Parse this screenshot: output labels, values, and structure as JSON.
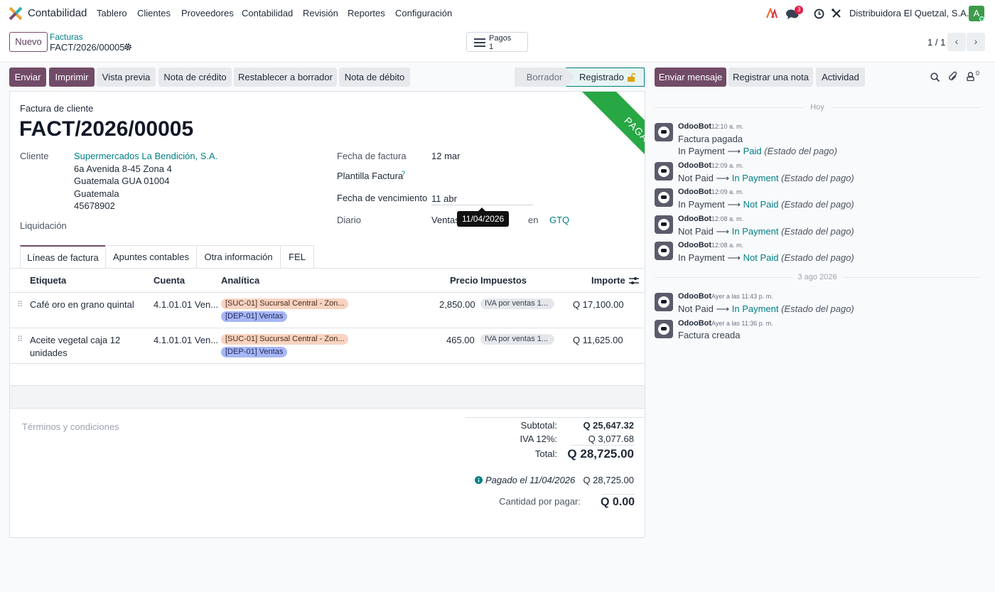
{
  "navbar": {
    "app_name": "Contabilidad",
    "menus": [
      "Tablero",
      "Clientes",
      "Proveedores",
      "Contabilidad",
      "Revisión",
      "Reportes",
      "Configuración"
    ],
    "messages_count": "3",
    "company": "Distribuidora El Quetzal, S.A.",
    "avatar_letter": "A"
  },
  "control": {
    "new_label": "Nuevo",
    "breadcrumb_parent": "Facturas",
    "breadcrumb_current": "FACT/2026/00005",
    "payments_label": "Pagos",
    "payments_count": "1",
    "pager": "1 / 1"
  },
  "actions": {
    "send": "Enviar",
    "print": "Imprimir",
    "preview": "Vista previa",
    "credit_note": "Nota de crédito",
    "reset_draft": "Restablecer a borrador",
    "debit_note": "Nota de débito"
  },
  "status": {
    "draft": "Borrador",
    "posted": "Registrado"
  },
  "form": {
    "ribbon": "PAGADO",
    "type": "Factura de cliente",
    "number": "FACT/2026/00005",
    "customer_label": "Cliente",
    "customer_name": "Supermercados La Bendición, S.A.",
    "address": [
      "6a Avenida 8-45 Zona 4",
      "Guatemala GUA 01004",
      "Guatemala",
      "45678902"
    ],
    "liquidation_label": "Liquidación",
    "invoice_date_label": "Fecha de factura",
    "invoice_date": "12 mar",
    "template_label": "Plantilla Factura",
    "template_help": "?",
    "due_date_label": "Fecha de vencimiento",
    "due_date": "11 abr",
    "due_tooltip": "11/04/2026",
    "journal_label": "Diario",
    "journal": "Ventas",
    "in_label": "en",
    "currency": "GTQ"
  },
  "tabs": [
    "Líneas de factura",
    "Apuntes contables",
    "Otra información",
    "FEL"
  ],
  "lines": {
    "headers": [
      "Etiqueta",
      "Cuenta",
      "Analítica",
      "Precio",
      "Impuestos",
      "Importe"
    ],
    "rows": [
      {
        "label": "Café oro en grano quintal",
        "account": "4.1.01.01 Ven...",
        "tag1": "[SUC-01] Sucursal Central - Zon...",
        "tag2": "[DEP-01] Ventas",
        "price": "2,850.00",
        "tax": "IVA por ventas 1...",
        "amount": "Q 17,100.00"
      },
      {
        "label": "Aceite vegetal caja 12 unidades",
        "account": "4.1.01.01 Ven...",
        "tag1": "[SUC-01] Sucursal Central - Zon...",
        "tag2": "[DEP-01] Ventas",
        "price": "465.00",
        "tax": "IVA por ventas 1...",
        "amount": "Q 11,625.00"
      }
    ]
  },
  "terms_placeholder": "Términos y condiciones",
  "totals": {
    "subtotal_label": "Subtotal:",
    "subtotal": "Q 25,647.32",
    "tax_label": "IVA 12%:",
    "tax": "Q 3,077.68",
    "total_label": "Total:",
    "total": "Q 28,725.00",
    "paid_label": "Pagado el 11/04/2026",
    "paid": "Q 28,725.00",
    "due_label": "Cantidad por pagar:",
    "due": "Q 0.00"
  },
  "chatter": {
    "send_message": "Enviar mensaje",
    "log_note": "Registrar una nota",
    "activity": "Actividad",
    "followers_count": "0",
    "today": "Hoy",
    "older_date": "3 ago 2026",
    "messages": [
      {
        "author": "OdooBot",
        "time": "12:10 a. m.",
        "title": "Factura pagada",
        "old": "In Payment",
        "new": "Paid",
        "field": "(Estado del pago)"
      },
      {
        "author": "OdooBot",
        "time": "12:09 a. m.",
        "old": "Not Paid",
        "new": "In Payment",
        "field": "(Estado del pago)"
      },
      {
        "author": "OdooBot",
        "time": "12:09 a. m.",
        "old": "In Payment",
        "new": "Not Paid",
        "field": "(Estado del pago)"
      },
      {
        "author": "OdooBot",
        "time": "12:08 a. m.",
        "old": "Not Paid",
        "new": "In Payment",
        "field": "(Estado del pago)"
      },
      {
        "author": "OdooBot",
        "time": "12:08 a. m.",
        "old": "In Payment",
        "new": "Not Paid",
        "field": "(Estado del pago)"
      },
      {
        "author": "OdooBot",
        "time": "Ayer a las 11:43 p. m.",
        "old": "Not Paid",
        "new": "In Payment",
        "field": "(Estado del pago)"
      },
      {
        "author": "OdooBot",
        "time": "Ayer a las 11:36 p. m.",
        "title": "Factura creada"
      }
    ]
  }
}
